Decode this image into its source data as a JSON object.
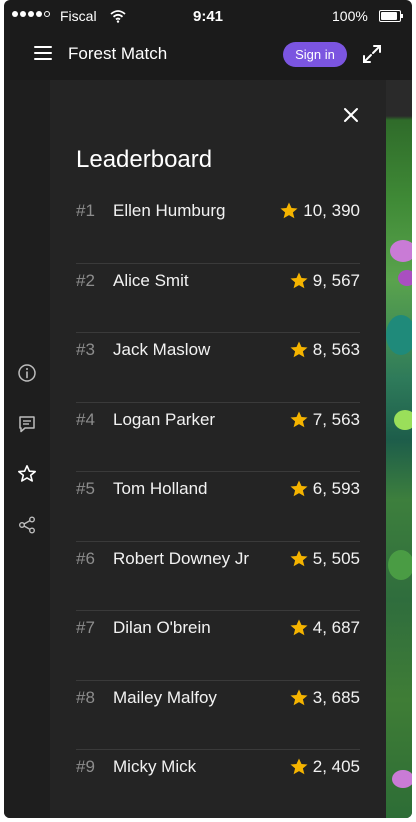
{
  "status_bar": {
    "carrier": "Fiscal",
    "time": "9:41",
    "battery": "100%",
    "battery_level": 1.0,
    "signal_bars_filled": 4
  },
  "app_bar": {
    "title": "Forest Match",
    "sign_in_label": "Sign in",
    "menu_icon": "hamburger-menu-icon",
    "fullscreen_icon": "expand-icon"
  },
  "sidebar": {
    "icons": [
      "info-icon",
      "feedback-icon",
      "star-icon",
      "share-icon"
    ],
    "active": "star-icon"
  },
  "leaderboard": {
    "title": "Leaderboard",
    "close_icon": "close-icon",
    "rows": [
      {
        "rank": "#1",
        "name": "Ellen Humburg",
        "score": "10, 390"
      },
      {
        "rank": "#2",
        "name": "Alice Smit",
        "score": "9, 567"
      },
      {
        "rank": "#3",
        "name": "Jack Maslow",
        "score": "8, 563"
      },
      {
        "rank": "#4",
        "name": "Logan Parker",
        "score": "7, 563"
      },
      {
        "rank": "#5",
        "name": "Tom Holland",
        "score": "6, 593"
      },
      {
        "rank": "#6",
        "name": "Robert Downey Jr",
        "score": "5, 505"
      },
      {
        "rank": "#7",
        "name": "Dilan O'brein",
        "score": "4, 687"
      },
      {
        "rank": "#8",
        "name": "Mailey Malfoy",
        "score": "3, 685"
      },
      {
        "rank": "#9",
        "name": "Micky Mick",
        "score": "2, 405"
      }
    ]
  },
  "colors": {
    "accent": "#7b55e0",
    "star": "#f5b400",
    "panel_bg": "#242424",
    "app_bg": "#1b1b1b"
  }
}
